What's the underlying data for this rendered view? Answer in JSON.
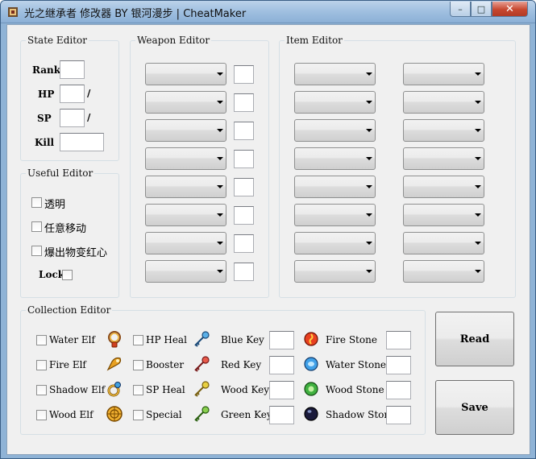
{
  "window": {
    "title": "光之继承者 修改器 BY 银河漫步 | CheatMaker"
  },
  "caption": {
    "minimize": "–",
    "maximize": "□",
    "close": "✕"
  },
  "state_editor": {
    "title": "State Editor",
    "rank_label": "Rank",
    "hp_label": "HP",
    "sp_label": "SP",
    "kill_label": "Kill",
    "separator": "/",
    "rank_value": "",
    "hp_value": "",
    "hp_max": "",
    "sp_value": "",
    "sp_max": "",
    "kill_value": ""
  },
  "useful_editor": {
    "title": "Useful Editor",
    "options": [
      "透明",
      "任意移动",
      "爆出物变红心"
    ],
    "lock_label": "Lock"
  },
  "weapon_editor": {
    "title": "Weapon Editor"
  },
  "item_editor": {
    "title": "Item Editor"
  },
  "collection_editor": {
    "title": "Collection Editor",
    "elves": [
      "Water Elf",
      "Fire Elf",
      "Shadow Elf",
      "Wood Elf"
    ],
    "items": [
      "HP Heal",
      "Booster",
      "SP Heal",
      "Special"
    ],
    "keys": [
      "Blue Key",
      "Red Key",
      "Wood Key",
      "Green Key"
    ],
    "stones": [
      "Fire Stone",
      "Water Stone",
      "Wood Stone",
      "Shadow Stone"
    ]
  },
  "buttons": {
    "read": "Read",
    "save": "Save"
  },
  "colors": {
    "titlebar": "#9fbfe0",
    "client_bg": "#f0f0f0",
    "close_button": "#c7472f"
  }
}
